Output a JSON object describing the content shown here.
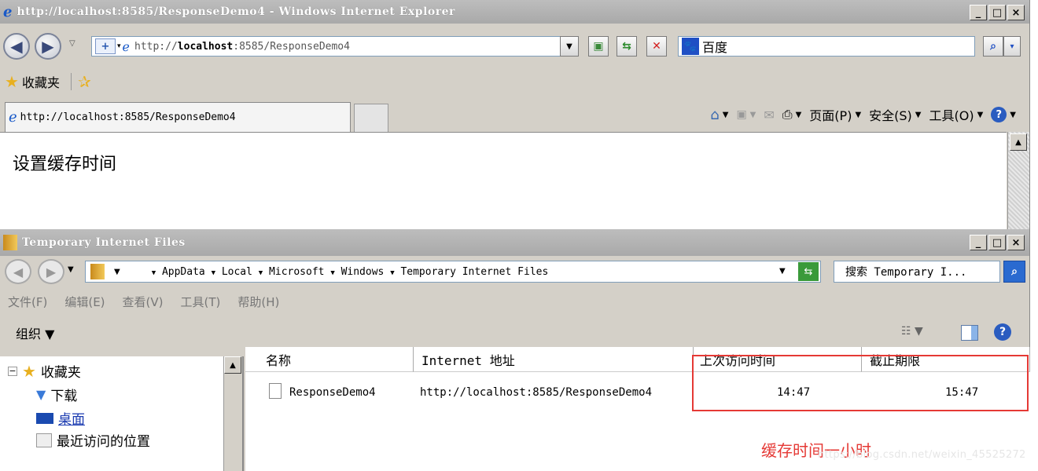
{
  "ie": {
    "title": "http://localhost:8585/ResponseDemo4 - Windows Internet Explorer",
    "address": {
      "prefix": "http://",
      "host": "localhost",
      "rest": ":8585/ResponseDemo4"
    },
    "search_placeholder": "百度",
    "favorites_label": "收藏夹",
    "tab_title": "http://localhost:8585/ResponseDemo4",
    "commands": [
      {
        "label": "页面(P)"
      },
      {
        "label": "安全(S)"
      },
      {
        "label": "工具(O)"
      }
    ],
    "page_text": "设置缓存时间",
    "window_buttons": [
      "_",
      "□",
      "×"
    ]
  },
  "explorer": {
    "title": "Temporary Internet Files",
    "breadcrumb": [
      "AppData",
      "Local",
      "Microsoft",
      "Windows",
      "Temporary Internet Files"
    ],
    "search_placeholder": "搜索 Temporary I...",
    "menus": [
      "文件(F)",
      "编辑(E)",
      "查看(V)",
      "工具(T)",
      "帮助(H)"
    ],
    "organize_label": "组织 ▼",
    "tree": [
      {
        "label": "收藏夹"
      },
      {
        "label": "下载"
      },
      {
        "label": "桌面"
      },
      {
        "label": "最近访问的位置"
      }
    ],
    "columns": [
      "名称",
      "Internet 地址",
      "上次访问时间",
      "截止期限"
    ],
    "rows": [
      {
        "name": "ResponseDemo4",
        "url": "http://localhost:8585/ResponseDemo4",
        "last_access": "14:47",
        "expires": "15:47"
      }
    ]
  },
  "annotation": {
    "note": "缓存时间一小时",
    "watermark": "https://blog.csdn.net/weixin_45525272",
    "box_color": "#e53935"
  }
}
